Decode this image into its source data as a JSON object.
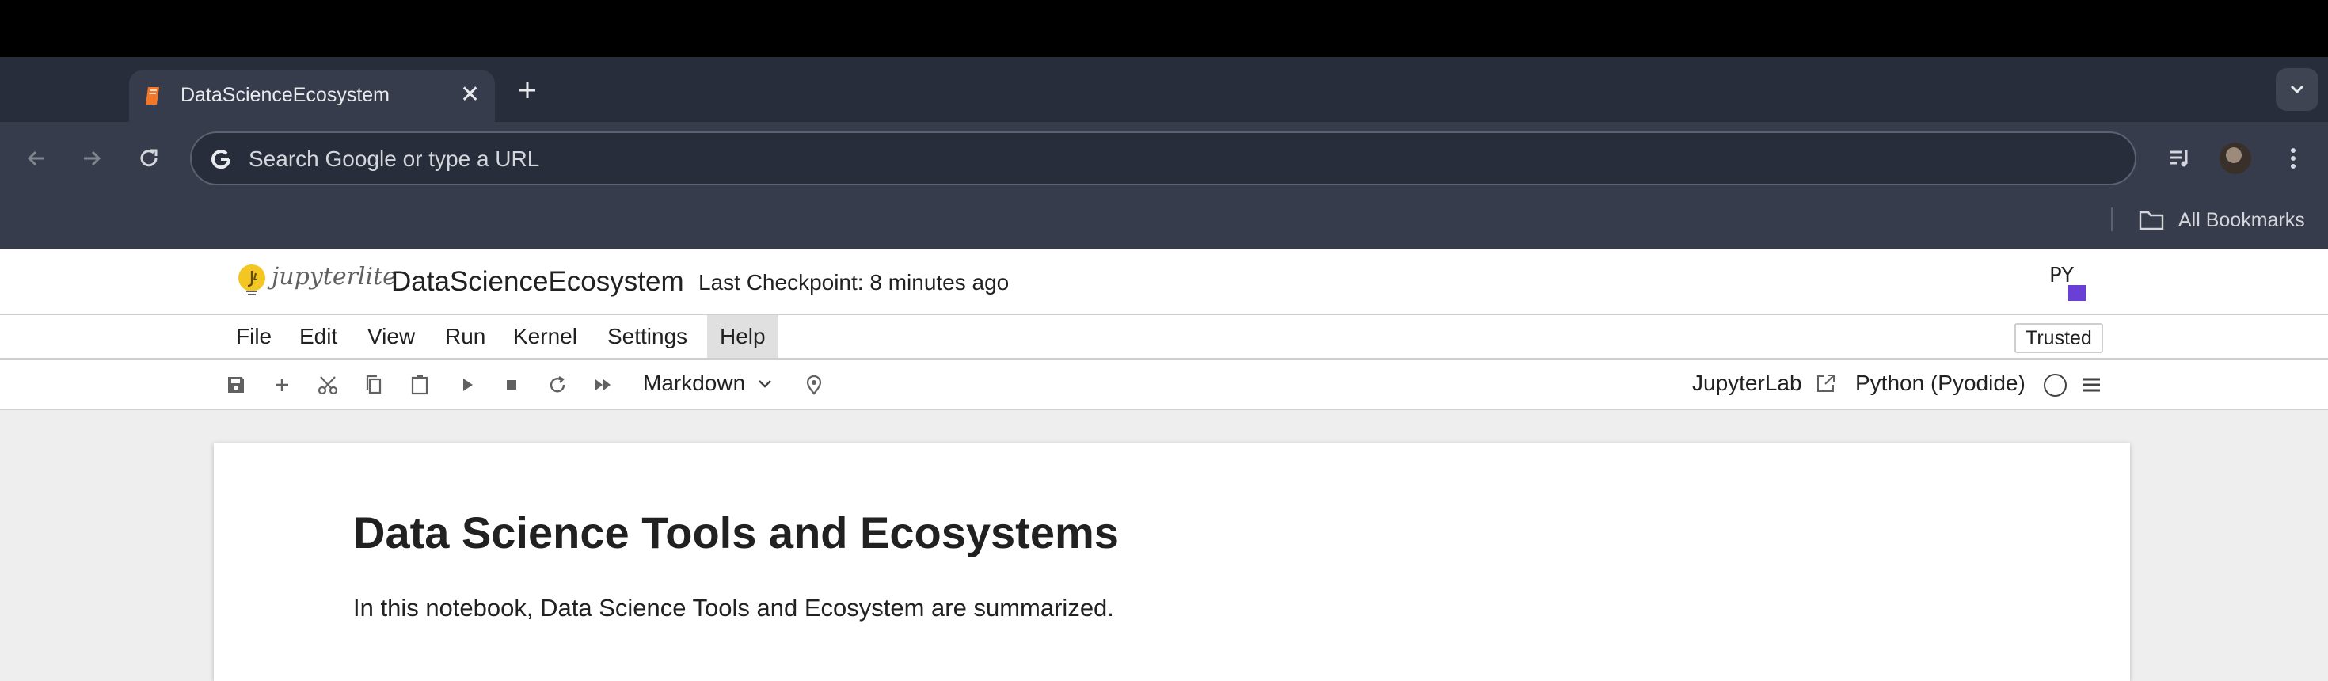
{
  "browser": {
    "tab": {
      "title": "DataScienceEcosystem",
      "favicon": "notebook-icon"
    },
    "new_tab_icon": "plus-icon",
    "omnibox": {
      "placeholder": "Search Google or type a URL"
    },
    "bookmarks": {
      "all_bookmarks_label": "All Bookmarks"
    }
  },
  "jupyter": {
    "logo_text": "jupyterlite",
    "notebook_title": "DataScienceEcosystem",
    "checkpoint": "Last Checkpoint: 8 minutes ago",
    "menu": [
      "File",
      "Edit",
      "View",
      "Run",
      "Kernel",
      "Settings",
      "Help"
    ],
    "active_menu": "Help",
    "trusted_label": "Trusted",
    "toolbar": {
      "cell_type": "Markdown",
      "jupyterlab_link": "JupyterLab",
      "kernel_name": "Python (Pyodide)"
    }
  },
  "notebook": {
    "heading": "Data Science Tools and Ecosystems",
    "paragraph": "In this notebook, Data Science Tools and Ecosystem are summarized."
  },
  "colors": {
    "chrome_bg": "#363c4b",
    "tabstrip_bg": "#272d3a",
    "accent_orange": "#f37726"
  }
}
